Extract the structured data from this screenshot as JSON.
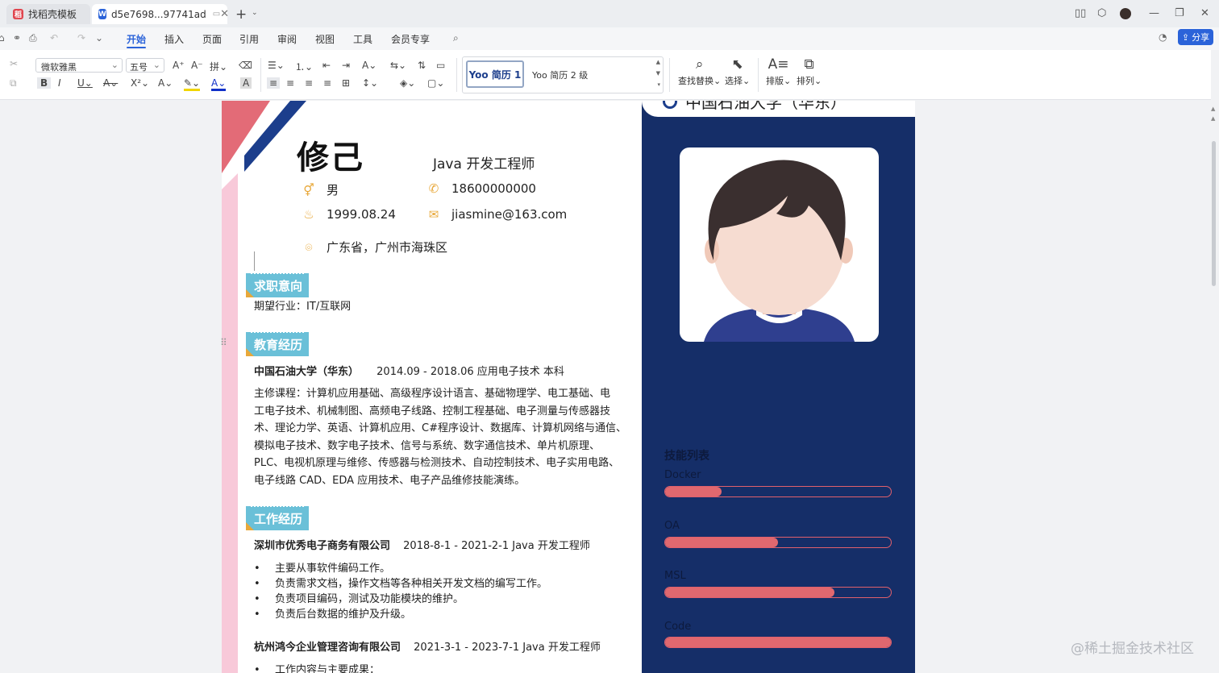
{
  "tabs": [
    {
      "label": "找稻壳模板",
      "active": false
    },
    {
      "label": "d5e7698...97741ad",
      "active": true
    }
  ],
  "menu": [
    "开始",
    "插入",
    "页面",
    "引用",
    "审阅",
    "视图",
    "工具",
    "会员专享"
  ],
  "share_label": "分享",
  "ribbon": {
    "font_name": "微软雅黑",
    "font_size": "五号",
    "style_1": "Yoo 简历 1",
    "style_2": "Yoo 简历 2 级",
    "find_replace": "查找替换",
    "select": "选择",
    "layout": "排版",
    "arrange": "排列"
  },
  "resume": {
    "name": "修己",
    "job_title": "Java 开发工程师",
    "gender": "男",
    "phone": "18600000000",
    "birthday": "1999.08.24",
    "email": "jiasmine@163.com",
    "location": "广东省，广州市海珠区",
    "university_header": "中国石油大学（华东）",
    "sections": {
      "objective": "求职意向",
      "education": "教育经历",
      "work": "工作经历"
    },
    "objective_text": "期望行业：IT/互联网",
    "education": {
      "school": "中国石油大学（华东）",
      "detail": "2014.09 - 2018.06  应用电子技术    本科",
      "courses": [
        "主修课程：计算机应用基础、高级程序设计语言、基础物理学、电工基础、电",
        "工电子技术、机械制图、高频电子线路、控制工程基础、电子测量与传感器技",
        "术、理论力学、英语、计算机应用、C#程序设计、数据库、计算机网络与通信、",
        "模拟电子技术、数字电子技术、信号与系统、数字通信技术、单片机原理、",
        "PLC、电视机原理与维修、传感器与检测技术、自动控制技术、电子实用电路、",
        "电子线路 CAD、EDA 应用技术、电子产品维修技能演练。"
      ]
    },
    "jobs": [
      {
        "company": "深圳市优秀电子商务有限公司",
        "detail": "2018-8-1 - 2021-2-1 Java 开发工程师",
        "items": [
          "主要从事软件编码工作。",
          "负责需求文档，操作文档等各种相关开发文档的编写工作。",
          "负责项目编码，测试及功能模块的维护。",
          "负责后台数据的维护及升级。"
        ]
      },
      {
        "company": "杭州鸿今企业管理咨询有限公司",
        "detail": "2021-3-1 - 2023-7-1 Java 开发工程师",
        "items": [
          "工作内容与主要成果："
        ]
      }
    ],
    "skills_title": "技能列表",
    "skills": [
      {
        "name": "Docker",
        "level": 0.25
      },
      {
        "name": "OA",
        "level": 0.5
      },
      {
        "name": "MSL",
        "level": 0.75
      },
      {
        "name": "Code",
        "level": 1.0
      }
    ]
  },
  "watermark": "@稀土掘金技术社区",
  "colors": {
    "accent": "#2b63d9",
    "navy": "#152e68",
    "section_tag": "#6ac0d8",
    "skill_bar": "#e0686f",
    "pink_corner": "#e36b77",
    "icon_gold": "#e8a83a"
  }
}
